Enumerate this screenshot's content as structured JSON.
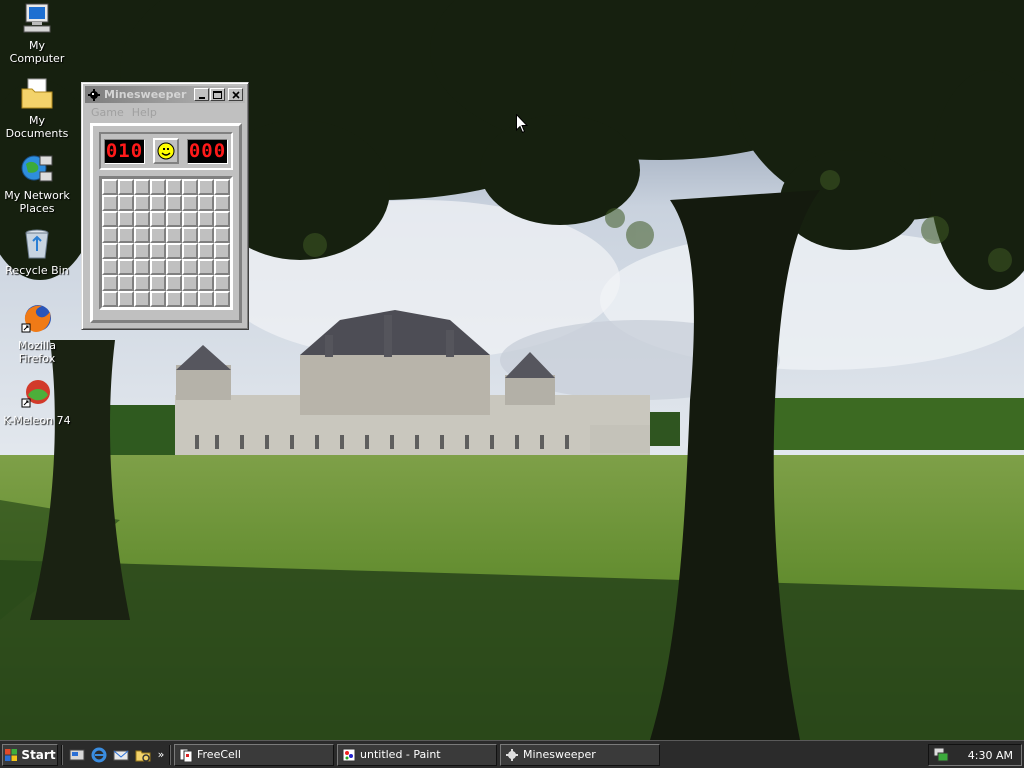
{
  "desktop": {
    "icons": [
      {
        "label": "My Computer",
        "icon": "my-computer-icon"
      },
      {
        "label": "My Documents",
        "icon": "my-documents-icon"
      },
      {
        "label": "My Network Places",
        "icon": "network-places-icon"
      },
      {
        "label": "Recycle Bin",
        "icon": "recycle-bin-icon"
      },
      {
        "label": "Mozilla Firefox",
        "icon": "firefox-icon"
      },
      {
        "label": "K-Meleon 74",
        "icon": "k-meleon-icon"
      }
    ]
  },
  "minesweeper": {
    "title": "Minesweeper",
    "menu": [
      "Game",
      "Help"
    ],
    "mines_counter": "010",
    "timer": "000",
    "grid": {
      "rows": 9,
      "cols": 9
    },
    "colors": {
      "led_text": "#ff1a1a",
      "face": "#ffff00"
    }
  },
  "taskbar": {
    "start_label": "Start",
    "quick_launch": [
      "show-desktop-icon",
      "internet-explorer-icon",
      "outlook-express-icon",
      "windows-explorer-icon"
    ],
    "overflow_label": "»",
    "tasks": [
      {
        "label": "FreeCell",
        "icon": "freecell-icon"
      },
      {
        "label": "untitled - Paint",
        "icon": "paint-icon"
      },
      {
        "label": "Minesweeper",
        "icon": "minesweeper-icon"
      }
    ],
    "clock": "4:30 AM"
  }
}
